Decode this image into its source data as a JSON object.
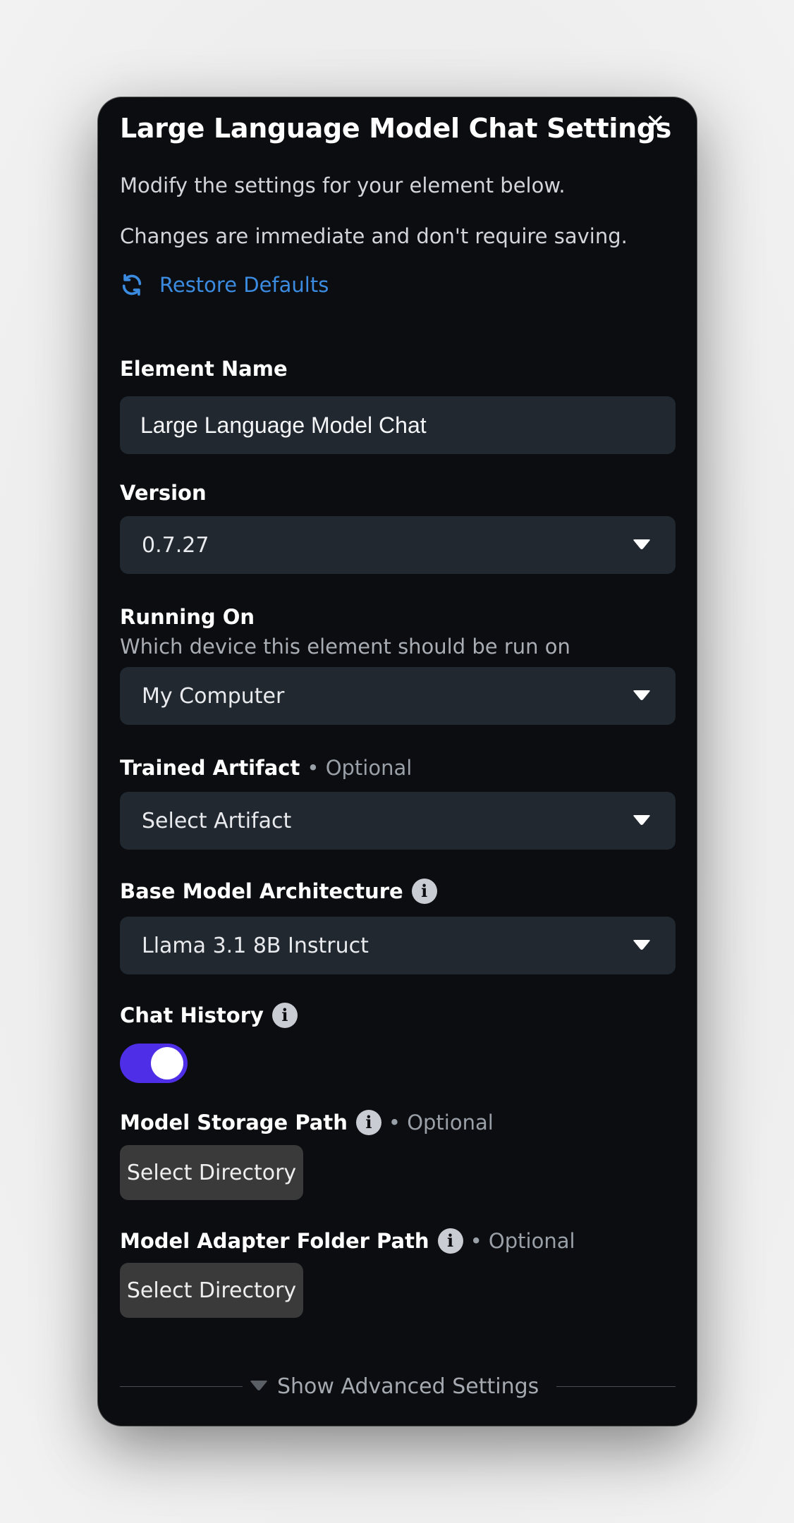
{
  "dialog": {
    "title": "Large Language Model Chat Settings",
    "close_label": "✕",
    "description_1": "Modify the settings for your element below.",
    "description_2": "Changes are immediate and don't require saving.",
    "restore_label": "Restore Defaults"
  },
  "fields": {
    "element_name": {
      "label": "Element Name",
      "value": "Large Language Model Chat"
    },
    "version": {
      "label": "Version",
      "value": "0.7.27"
    },
    "running_on": {
      "label": "Running On",
      "hint": "Which device this element should be run on",
      "value": "My Computer"
    },
    "trained_artifact": {
      "label": "Trained Artifact",
      "optional": "• Optional",
      "value": "Select Artifact"
    },
    "base_model": {
      "label": "Base Model Architecture",
      "value": "Llama 3.1 8B Instruct"
    },
    "chat_history": {
      "label": "Chat History",
      "enabled": true
    },
    "model_storage_path": {
      "label": "Model Storage Path",
      "optional": "• Optional",
      "button": "Select Directory"
    },
    "adapter_folder_path": {
      "label": "Model Adapter Folder Path",
      "optional": "• Optional",
      "button": "Select Directory"
    }
  },
  "advanced": {
    "label": "Show Advanced Settings"
  },
  "colors": {
    "panel_bg": "#0c0d11",
    "field_bg": "#212830",
    "accent_link": "#3b8be0",
    "toggle_on": "#4f2ee8",
    "button_bg": "#3a3a3a"
  },
  "icons": {
    "close": "close-icon",
    "restore": "refresh-icon",
    "info": "info-icon",
    "dropdown": "chevron-down-icon"
  }
}
